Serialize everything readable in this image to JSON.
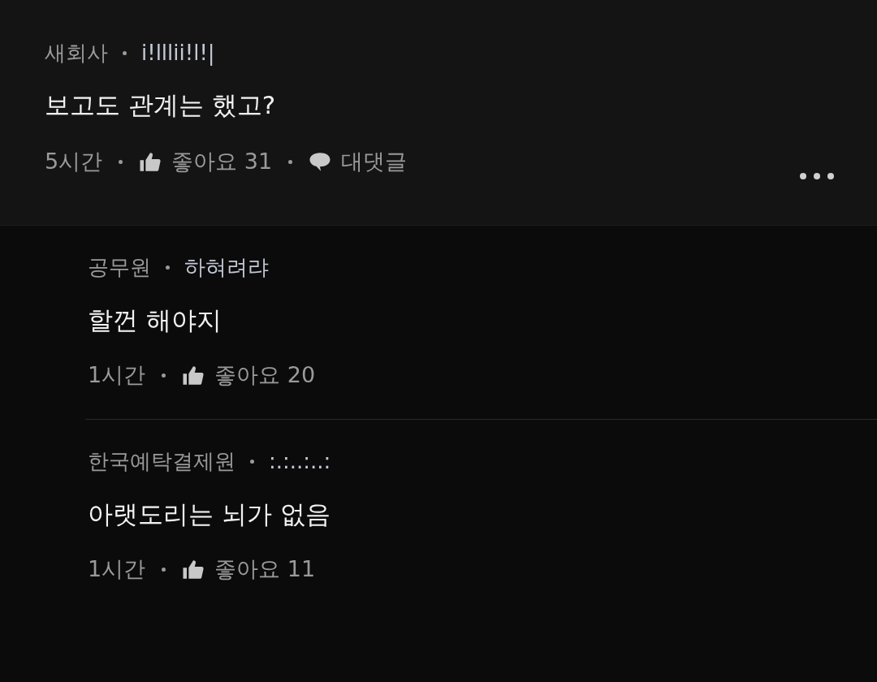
{
  "comment": {
    "company": "새회사",
    "nickname": "i!lllii!l!|",
    "text": "보고도 관계는 했고?",
    "time": "5시간",
    "like_label": "좋아요",
    "likes": "31",
    "reply_label": "대댓글"
  },
  "replies": [
    {
      "company": "공무원",
      "nickname": "하혀려랴",
      "text": "할껀 해야지",
      "time": "1시간",
      "like_label": "좋아요",
      "likes": "20"
    },
    {
      "company": "한국예탁결제원",
      "nickname": ":.:..:..:",
      "text": "아랫도리는 뇌가 없음",
      "time": "1시간",
      "like_label": "좋아요",
      "likes": "11"
    }
  ]
}
